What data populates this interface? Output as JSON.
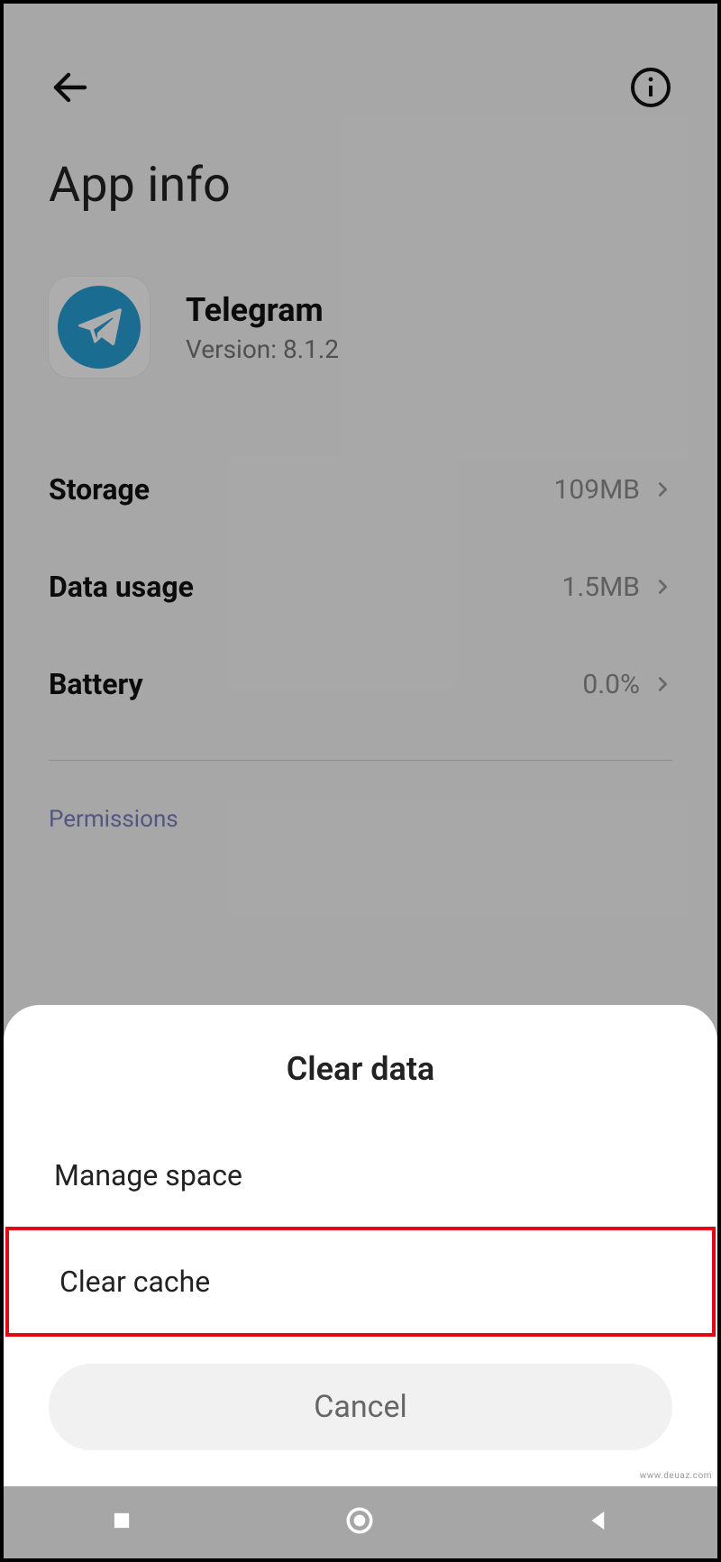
{
  "header": {
    "title": "App info"
  },
  "app": {
    "name": "Telegram",
    "version_label": "Version: 8.1.2"
  },
  "settings": {
    "storage": {
      "label": "Storage",
      "value": "109MB"
    },
    "data_usage": {
      "label": "Data usage",
      "value": "1.5MB"
    },
    "battery": {
      "label": "Battery",
      "value": "0.0%"
    }
  },
  "sections": {
    "permissions": "Permissions"
  },
  "sheet": {
    "title": "Clear data",
    "manage_space": "Manage space",
    "clear_cache": "Clear cache",
    "cancel": "Cancel"
  },
  "watermark": "www.deuaz.com"
}
